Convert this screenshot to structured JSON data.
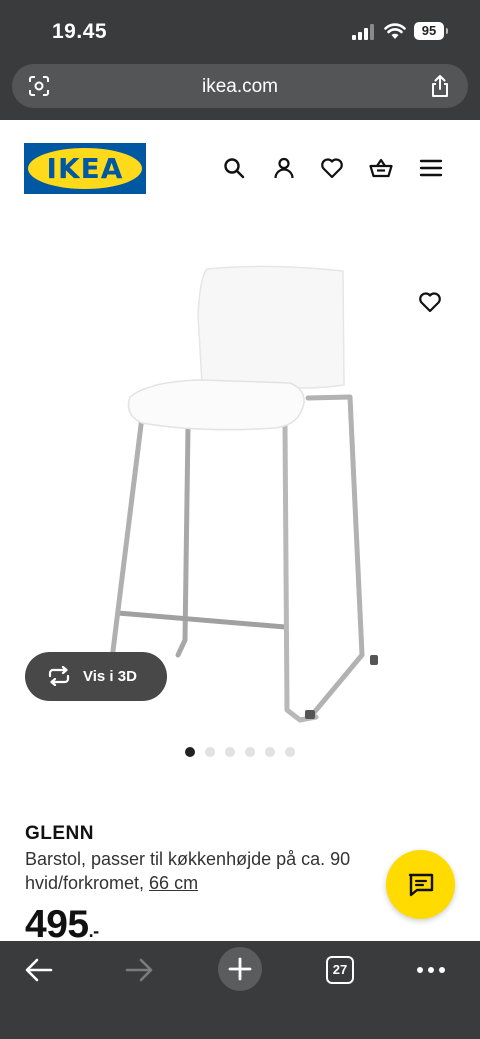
{
  "status_bar": {
    "time": "19.45",
    "battery": "95"
  },
  "browser": {
    "url": "ikea.com",
    "open_tabs": "27"
  },
  "header": {
    "logo_text": "IKEA",
    "icons": [
      "search-icon",
      "user-icon",
      "heart-icon",
      "basket-icon",
      "menu-icon"
    ]
  },
  "gallery": {
    "view_3d_label": "Vis i 3D",
    "image_count": 6,
    "active_image": 1
  },
  "product": {
    "name": "GLENN",
    "description_line1": "Barstol, passer til køkkenhøjde på ca. 90",
    "description_line2": "hvid/forkromet, ",
    "size_link": "66 cm",
    "price": "495",
    "price_suffix": ".-"
  },
  "colors": {
    "ikea_blue": "#0058a3",
    "ikea_yellow": "#ffda1a",
    "browser_chrome": "#3a3b3d"
  }
}
